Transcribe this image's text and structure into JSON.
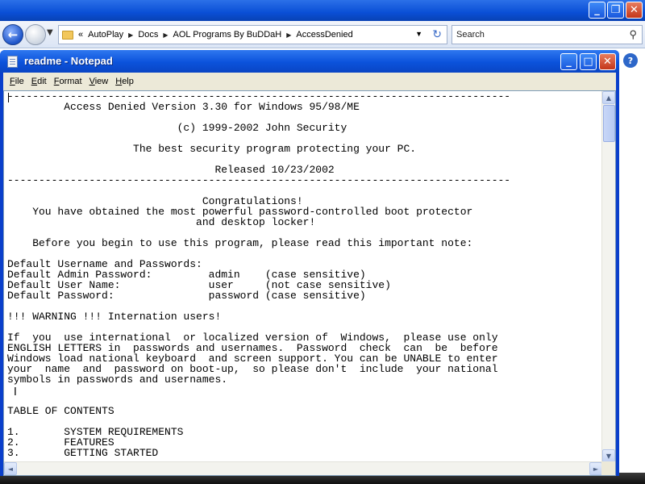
{
  "explorer": {
    "breadcrumb": [
      "AutoPlay",
      "Docs",
      "AOL Programs By BuDDaH",
      "AccessDenied"
    ],
    "search_placeholder": "Search",
    "breadcrumb_prefix": "«"
  },
  "notepad": {
    "title": "readme - Notepad",
    "menus": [
      "File",
      "Edit",
      "Format",
      "View",
      "Help"
    ],
    "content_lines": [
      "--------------------------------------------------------------------------------",
      "         Access Denied Version 3.30 for Windows 95/98/ME",
      "",
      "                           (c) 1999-2002 John Security",
      "",
      "                    The best security program protecting your PC.",
      "",
      "                                 Released 10/23/2002",
      "--------------------------------------------------------------------------------",
      "",
      "                               Congratulations!",
      "    You have obtained the most powerful password-controlled boot protector",
      "                              and desktop locker!",
      "",
      "    Before you begin to use this program, please read this important note:",
      "",
      "Default Username and Passwords:",
      "Default Admin Password:         admin    (case sensitive)",
      "Default User Name:              user     (not case sensitive)",
      "Default Password:               password (case sensitive)",
      "",
      "!!! WARNING !!! Internation users!",
      "",
      "If  you  use international  or localized version of  Windows,  please use only",
      "ENGLISH LETTERS in  passwords and usernames.  Password  check  can  be  before",
      "Windows load national keyboard  and screen support. You can be UNABLE to enter",
      "your  name  and  password on boot-up,  so please don't  include  your national",
      "symbols in passwords and usernames.",
      "",
      "",
      "TABLE OF CONTENTS",
      "",
      "1.       SYSTEM REQUIREMENTS",
      "2.       FEATURES",
      "3.       GETTING STARTED"
    ]
  },
  "icons": {
    "back": "←",
    "minimize": "_",
    "maximize": "□",
    "close": "✕",
    "restore": "❐",
    "help": "?",
    "search": "⚲",
    "refresh": "↻",
    "dropdown": "▼",
    "scroll_up": "▲",
    "scroll_down": "▼",
    "scroll_left": "◄",
    "scroll_right": "►"
  }
}
